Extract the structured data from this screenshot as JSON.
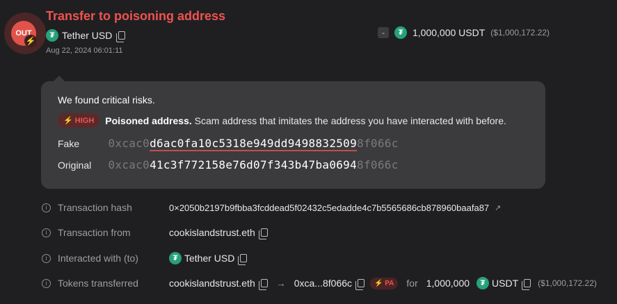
{
  "header": {
    "title": "Transfer to poisoning address",
    "badge": "OUT",
    "token_name": "Tether USD",
    "date": "Aug 22, 2024 06:01:11",
    "amount_sign": "-",
    "amount": "1,000,000 USDT",
    "amount_usd": "($1,000,172.22)"
  },
  "risk": {
    "title": "We found critical risks.",
    "level": "HIGH",
    "headline": "Poisoned address.",
    "description": "Scam address that imitates the address you have interacted with before.",
    "fake_label": "Fake",
    "original_label": "Original",
    "fake": {
      "prefix": "0xcac0",
      "middle": "d6ac0fa10c5318e949dd949883250",
      "tail_bright": "9",
      "suffix": "8f066c"
    },
    "original": {
      "prefix": "0xcac0",
      "middle": "41c3f772158e76d07f343b47ba0694",
      "suffix": "8f066c"
    }
  },
  "details": {
    "tx_hash_label": "Transaction hash",
    "tx_hash": "0×2050b2197b9fbba3fcddead5f02432c5edadde4c7b5565686cb878960baafa87",
    "from_label": "Transaction from",
    "from": "cookislandstrust.eth",
    "to_label": "Interacted with (to)",
    "to": "Tether USD",
    "tokens_label": "Tokens transferred",
    "tokens_from": "cookislandstrust.eth",
    "tokens_to": "0xca...8f066c",
    "pa_badge": "PA",
    "for": "for",
    "tokens_amount": "1,000,000",
    "tokens_symbol": "USDT",
    "tokens_usd": "($1,000,172.22)"
  },
  "colors": {
    "background": "#1f1f21",
    "danger": "#ef5350",
    "tether": "#26a17b",
    "card": "#3b3b3e"
  }
}
